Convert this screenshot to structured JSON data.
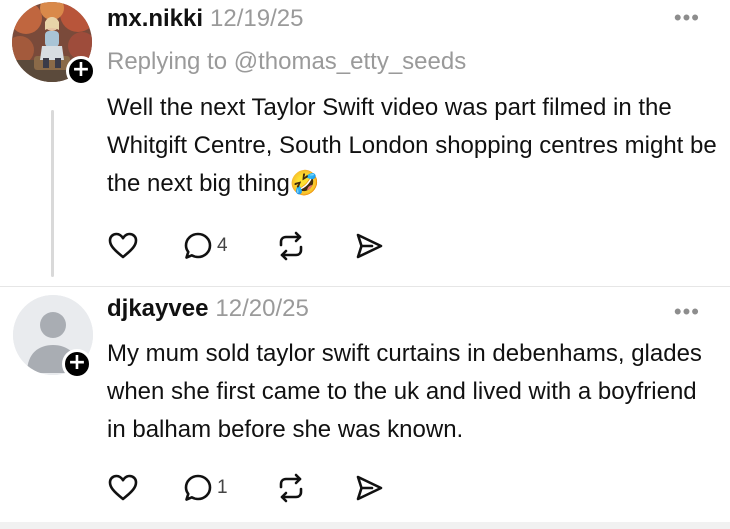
{
  "posts": [
    {
      "username": "mx.nikki",
      "timestamp": "12/19/25",
      "replying_to": "Replying to @thomas_etty_seeds",
      "text": "Well the next Taylor Swift video was part filmed in the Whitgift Centre, South London shopping centres might be the next big thing🤣",
      "avatar": "photo-avatar",
      "reply_count": "4"
    },
    {
      "username": "djkayvee",
      "timestamp": "12/20/25",
      "text": "My mum sold taylor swift curtains in debenhams, glades when she first came to the uk and lived with a boyfriend in balham before she was known.",
      "avatar": "default-avatar",
      "reply_count": "1"
    }
  ],
  "icons": {
    "more": "more-icon",
    "follow": "follow-plus-icon",
    "like": "heart-icon",
    "reply": "comment-icon",
    "repost": "repost-icon",
    "share": "send-icon"
  },
  "ui": {
    "more_label": "•••",
    "follow_label": "+"
  }
}
